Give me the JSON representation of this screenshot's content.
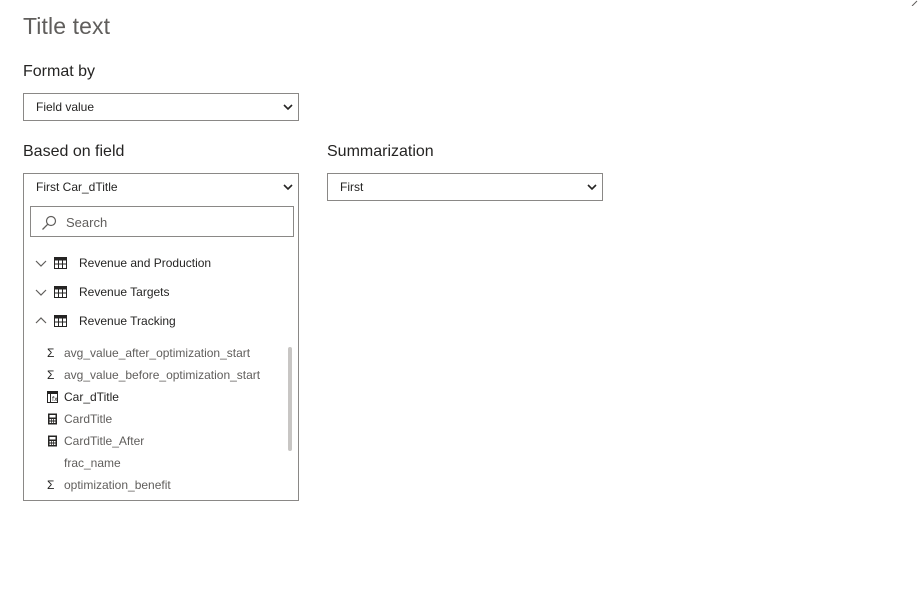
{
  "title": "Title text",
  "format_by": {
    "label": "Format by",
    "value": "Field value"
  },
  "based_on_field": {
    "label": "Based on field",
    "value": "First Car_dTitle",
    "search_placeholder": "Search",
    "tables": [
      {
        "name": "Revenue and Production",
        "expanded": false
      },
      {
        "name": "Revenue Targets",
        "expanded": false
      },
      {
        "name": "Revenue Tracking",
        "expanded": true
      }
    ],
    "fields": [
      {
        "name": "avg_value_after_optimization_start",
        "icon": "sigma-icon"
      },
      {
        "name": "avg_value_before_optimization_start",
        "icon": "sigma-icon"
      },
      {
        "name": "Car_dTitle",
        "icon": "calculated-column-icon"
      },
      {
        "name": "CardTitle",
        "icon": "calculator-icon"
      },
      {
        "name": "CardTitle_After",
        "icon": "calculator-icon"
      },
      {
        "name": "frac_name",
        "icon": "none"
      },
      {
        "name": "optimization_benefit",
        "icon": "sigma-icon"
      }
    ]
  },
  "summarization": {
    "label": "Summarization",
    "value": "First"
  }
}
